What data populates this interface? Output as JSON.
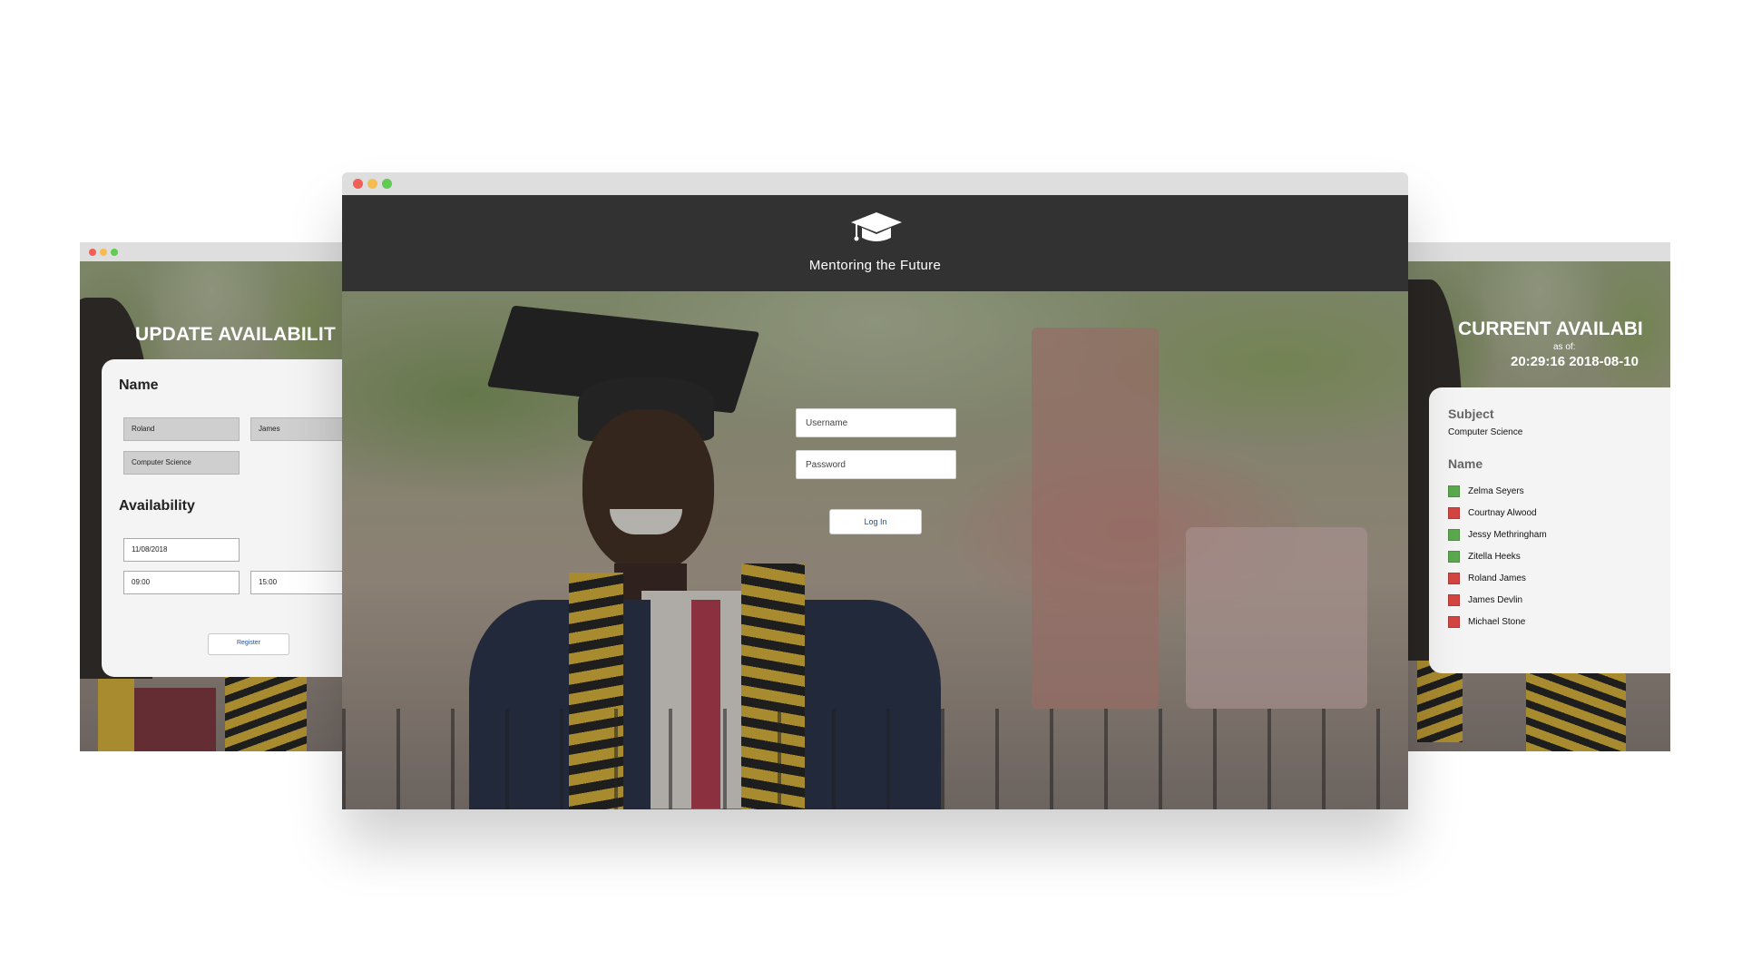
{
  "colors": {
    "titlebar": "#dedede",
    "header_band": "#323232",
    "dot_close": "#f25f57",
    "dot_minimize": "#f5bd4f",
    "dot_maximize": "#5fcb50",
    "available": "#5ba84e",
    "unavailable": "#d34540",
    "link_blue": "#1c4f9c"
  },
  "main_window": {
    "header": {
      "title": "Mentoring the Future",
      "icon": "graduation-cap-icon"
    },
    "login": {
      "username_placeholder": "Username",
      "password_placeholder": "Password",
      "login_label": "Log In"
    }
  },
  "left_window": {
    "heading": "UPDATE AVAILABILIT",
    "name_section": "Name",
    "first_name": "Roland",
    "last_name": "James",
    "subject": "Computer Science",
    "availability_section": "Availability",
    "date": "11/08/2018",
    "start_time": "09:00",
    "end_time": "15:00",
    "register_label": "Register"
  },
  "right_window": {
    "heading": "CURRENT AVAILABI",
    "as_of_label": "as of:",
    "timestamp": "20:29:16 2018-08-10",
    "subject_heading": "Subject",
    "subject_value": "Computer Science",
    "name_heading": "Name",
    "mentors": [
      {
        "name": "Zelma Seyers",
        "available": true
      },
      {
        "name": "Courtnay Alwood",
        "available": false
      },
      {
        "name": "Jessy Methringham",
        "available": true
      },
      {
        "name": "Zitella Heeks",
        "available": true
      },
      {
        "name": "Roland James",
        "available": false
      },
      {
        "name": "James Devlin",
        "available": false
      },
      {
        "name": "Michael Stone",
        "available": false
      }
    ]
  }
}
